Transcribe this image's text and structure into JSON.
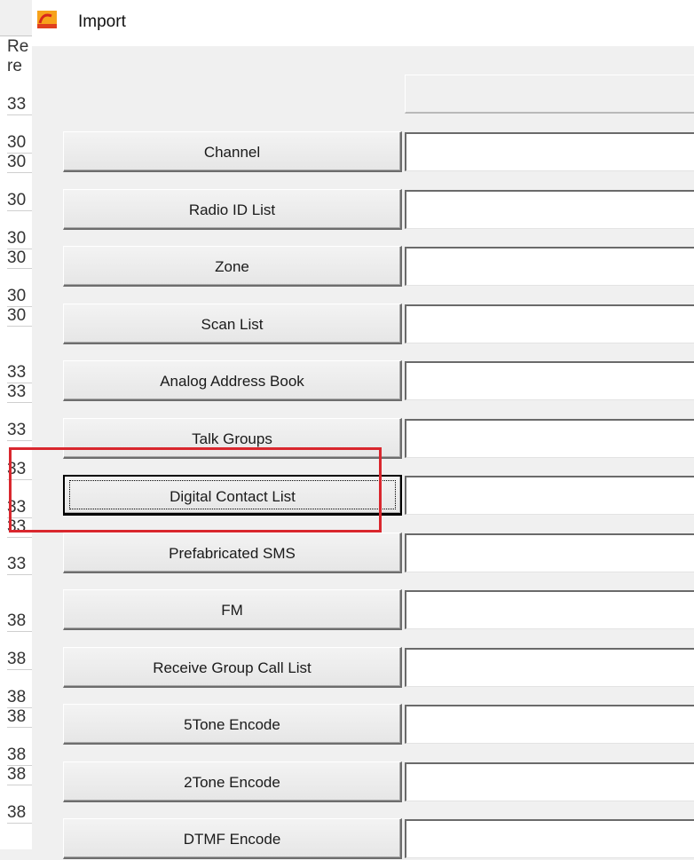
{
  "window": {
    "title": "Import",
    "icon": "app-logo-icon"
  },
  "background_list": {
    "header": [
      "Re",
      "re"
    ],
    "rows": [
      "33",
      "30",
      "30",
      "30",
      "30",
      "30",
      "30",
      "30",
      "33",
      "33",
      "33",
      "33",
      "33",
      "33",
      "33",
      "",
      "38",
      "38",
      "38",
      "38",
      "38",
      "38",
      "38"
    ]
  },
  "import_items": [
    {
      "label": "Channel",
      "value": ""
    },
    {
      "label": "Radio ID List",
      "value": ""
    },
    {
      "label": "Zone",
      "value": ""
    },
    {
      "label": "Scan List",
      "value": ""
    },
    {
      "label": "Analog Address Book",
      "value": ""
    },
    {
      "label": "Talk Groups",
      "value": ""
    },
    {
      "label": "Digital Contact List",
      "value": "",
      "focused": true,
      "highlighted": true
    },
    {
      "label": "Prefabricated SMS",
      "value": ""
    },
    {
      "label": "FM",
      "value": ""
    },
    {
      "label": "Receive Group Call List",
      "value": ""
    },
    {
      "label": "5Tone Encode",
      "value": ""
    },
    {
      "label": "2Tone Encode",
      "value": ""
    },
    {
      "label": "DTMF Encode",
      "value": ""
    }
  ],
  "colors": {
    "highlight": "#d9272e",
    "dialog_bg": "#f0f0f0"
  }
}
